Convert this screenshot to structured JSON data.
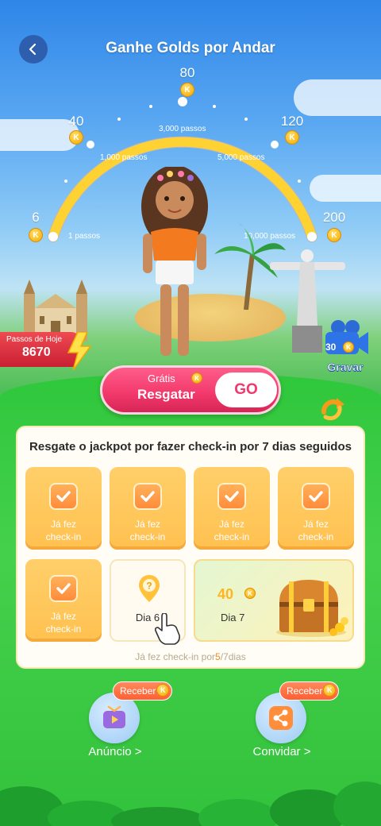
{
  "header": {
    "title": "Ganhe Golds por Andar",
    "back_icon": "back-arrow-icon"
  },
  "milestones": [
    {
      "reward": "6",
      "steps": "1 passos"
    },
    {
      "reward": "40",
      "steps": "1,000 passos"
    },
    {
      "reward": "80",
      "steps": "3,000 passos"
    },
    {
      "reward": "120",
      "steps": "5,000 passos"
    },
    {
      "reward": "200",
      "steps": "10,000 passos"
    }
  ],
  "coin_symbol": "K",
  "today_steps": {
    "label": "Passos de Hoje",
    "value": "8670"
  },
  "record": {
    "count": "30",
    "label": "Gravar"
  },
  "claim": {
    "free_label": "Grátis",
    "label": "Resgatar",
    "go_label": "GO"
  },
  "checkin": {
    "title": "Resgate o jackpot por fazer check-in por 7 dias seguidos",
    "done_label": "Já fez\ncheck-in",
    "day6_label": "Dia 6",
    "day7_label": "Dia 7",
    "day7_reward": "40",
    "progress_prefix": "Já fez check-in por",
    "progress_done": "5",
    "progress_suffix": "/7dias"
  },
  "tasks": [
    {
      "label": "Anúncio >",
      "pill": "Receber",
      "icon": "video-ad-icon"
    },
    {
      "label": "Convidar >",
      "pill": "Receber",
      "icon": "share-icon"
    }
  ],
  "colors": {
    "accent_pink": "#f2386b",
    "gold": "#ffc150",
    "green": "#2fc73c"
  }
}
